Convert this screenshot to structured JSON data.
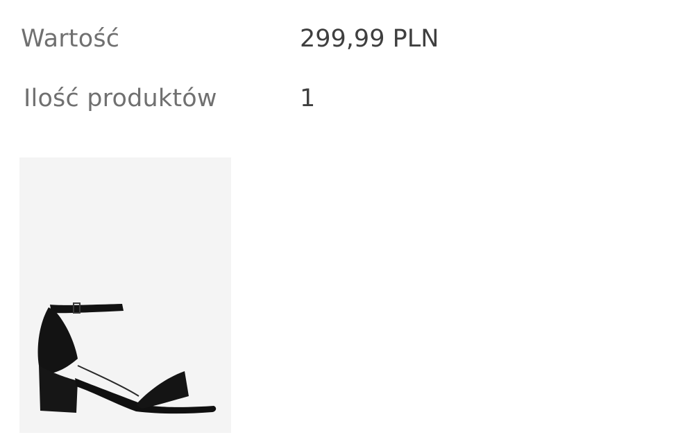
{
  "summary": {
    "rows": [
      {
        "label": "Wartość",
        "value": "299,99 PLN"
      },
      {
        "label": "Ilość produktów",
        "value": "1"
      }
    ]
  },
  "product": {
    "image_alt": "black block-heel ankle strap sandal",
    "image_background": "#f4f4f4",
    "shoe_color": "#111111"
  }
}
